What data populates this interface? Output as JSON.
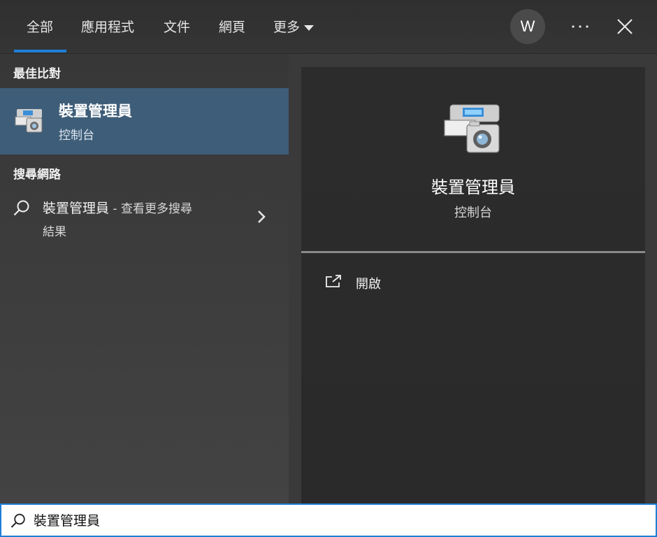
{
  "tabs": {
    "all": "全部",
    "apps": "應用程式",
    "documents": "文件",
    "web": "網頁",
    "more": "更多"
  },
  "account": {
    "initial": "W"
  },
  "sections": {
    "best_match": "最佳比對",
    "search_web": "搜尋網路"
  },
  "best_match": {
    "title": "裝置管理員",
    "subtitle": "控制台",
    "icon": "device-manager-icon"
  },
  "web_result": {
    "query": "裝置管理員",
    "suffix": " - 查看更多搜尋",
    "line2": "結果"
  },
  "detail": {
    "title": "裝置管理員",
    "subtitle": "控制台",
    "actions": [
      {
        "label": "開啟",
        "icon": "open-external-icon"
      }
    ]
  },
  "search": {
    "value": "裝置管理員"
  },
  "colors": {
    "accent": "#1f7fd6",
    "selected_row": "#3e5d78"
  }
}
